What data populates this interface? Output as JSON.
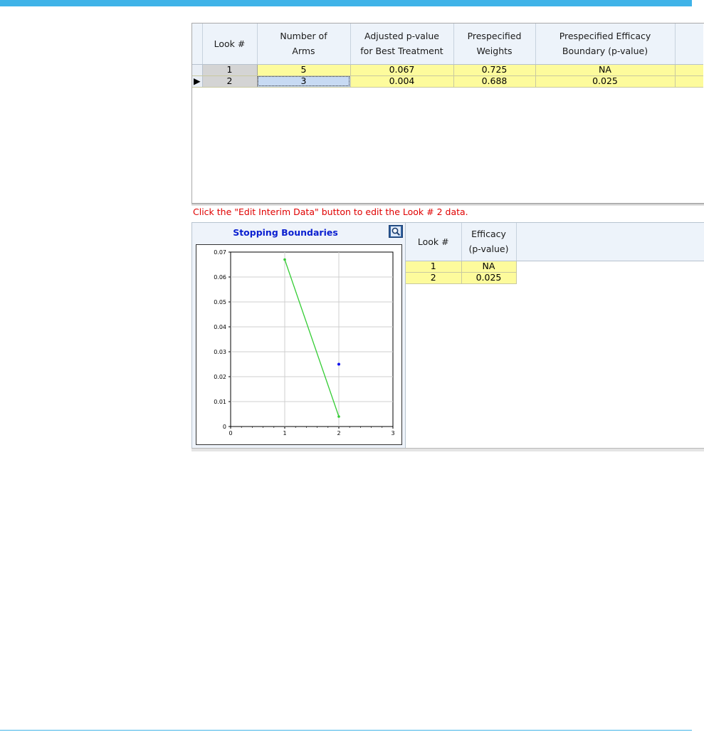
{
  "main_grid": {
    "columns": [
      {
        "line1": "Look #",
        "line2": ""
      },
      {
        "line1": "Number of",
        "line2": "Arms"
      },
      {
        "line1": "Adjusted p-value",
        "line2": "for Best Treatment"
      },
      {
        "line1": "Prespecified",
        "line2": "Weights"
      },
      {
        "line1": "Prespecified Efficacy",
        "line2": "Boundary (p-value)"
      }
    ],
    "rows": [
      {
        "look": "1",
        "arms": "5",
        "adj_p": "0.067",
        "weights": "0.725",
        "boundary": "NA"
      },
      {
        "look": "2",
        "arms": "3",
        "adj_p": "0.004",
        "weights": "0.688",
        "boundary": "0.025"
      }
    ],
    "current_row_marker": "▶"
  },
  "message": "Click the \"Edit Interim Data\" button to edit the Look # 2 data.",
  "chart_panel": {
    "title": "Stopping Boundaries",
    "zoom_icon": "magnifier-icon"
  },
  "chart_data": {
    "type": "line",
    "title": "Stopping Boundaries",
    "xlim": [
      0,
      3
    ],
    "ylim": [
      0,
      0.07
    ],
    "x_ticks": [
      "0",
      "1",
      "2",
      "3"
    ],
    "y_ticks": [
      "0",
      "0.01",
      "0.02",
      "0.03",
      "0.04",
      "0.05",
      "0.06",
      "0.07"
    ],
    "grid": true,
    "series": [
      {
        "color": "#33cc33",
        "points": [
          [
            1,
            0.067
          ],
          [
            2,
            0.004
          ]
        ],
        "style": "line"
      },
      {
        "color": "#1010ee",
        "points": [
          [
            2,
            0.025
          ]
        ],
        "style": "point"
      }
    ]
  },
  "efficacy_table": {
    "columns": [
      {
        "line1": "Look #",
        "line2": ""
      },
      {
        "line1": "Efficacy",
        "line2": "(p-value)"
      }
    ],
    "rows": [
      {
        "look": "1",
        "efficacy": "NA"
      },
      {
        "look": "2",
        "efficacy": "0.025"
      }
    ]
  }
}
